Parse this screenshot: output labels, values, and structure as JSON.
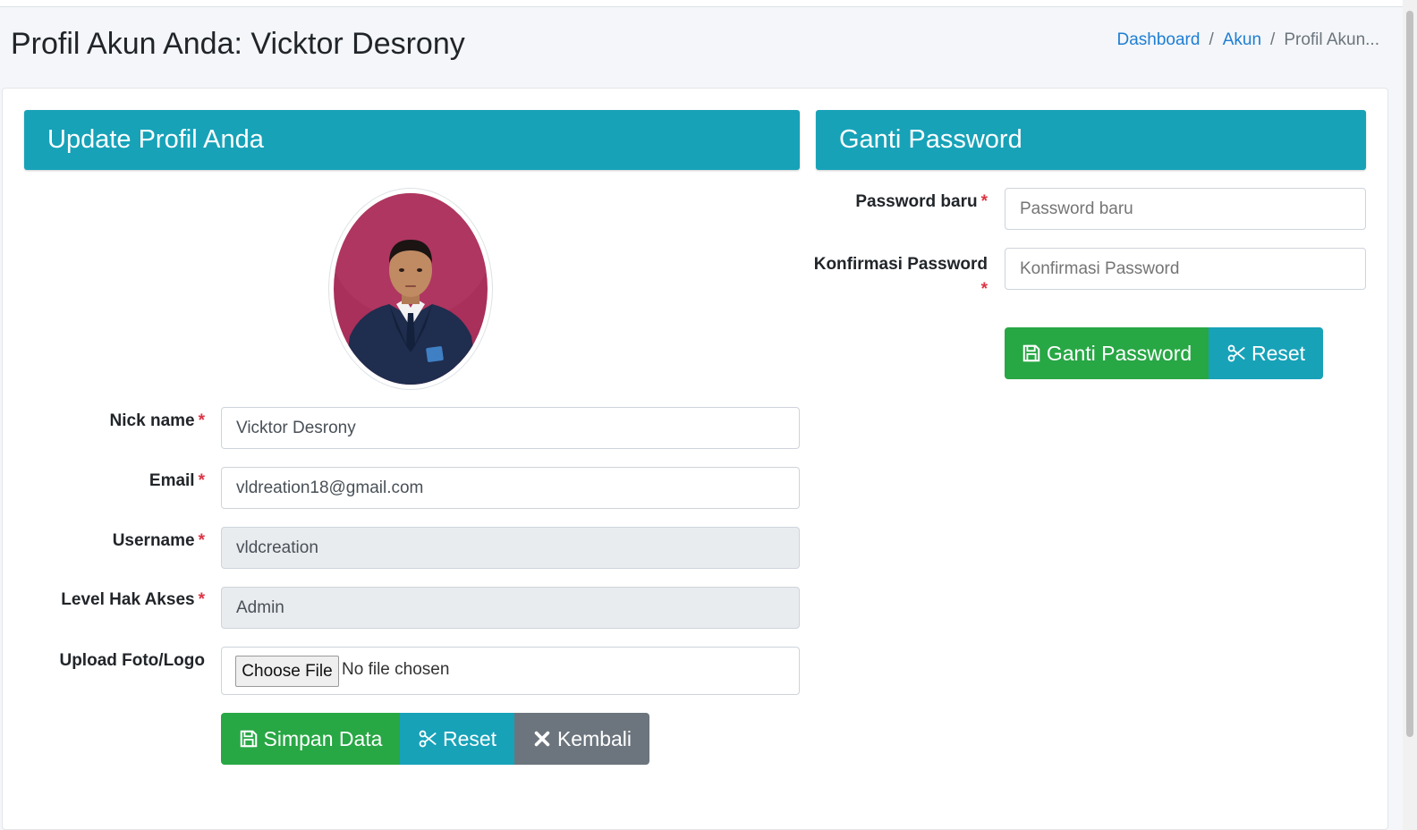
{
  "page": {
    "title": "Profil Akun Anda: Vicktor Desrony"
  },
  "breadcrumb": {
    "items": [
      "Dashboard",
      "Akun"
    ],
    "separator": "/",
    "active": "Profil Akun..."
  },
  "profile_panel": {
    "heading": "Update Profil Anda",
    "required_mark": "*",
    "nickname": {
      "label": "Nick name",
      "value": "Vicktor Desrony"
    },
    "email": {
      "label": "Email",
      "value": "vldreation18@gmail.com"
    },
    "username": {
      "label": "Username",
      "value": "vldcreation"
    },
    "level": {
      "label": "Level Hak Akses",
      "value": "Admin"
    },
    "upload": {
      "label": "Upload Foto/Logo",
      "button": "Choose File",
      "status": "No file chosen"
    },
    "buttons": {
      "save": "Simpan Data",
      "reset": "Reset",
      "back": "Kembali"
    }
  },
  "password_panel": {
    "heading": "Ganti Password",
    "required_mark": "*",
    "new_password": {
      "label": "Password baru",
      "placeholder": "Password baru"
    },
    "confirm_password": {
      "label": "Konfirmasi Password",
      "placeholder": "Konfirmasi Password"
    },
    "buttons": {
      "change": "Ganti Password",
      "reset": "Reset"
    }
  },
  "icons": {
    "save": "floppy-disk-icon",
    "reset": "scissors-icon",
    "back": "close-icon"
  },
  "colors": {
    "primary_info": "#17a2b8",
    "success": "#28a745",
    "secondary": "#6c757d",
    "link": "#1e7ed3",
    "required": "#dc3545"
  }
}
